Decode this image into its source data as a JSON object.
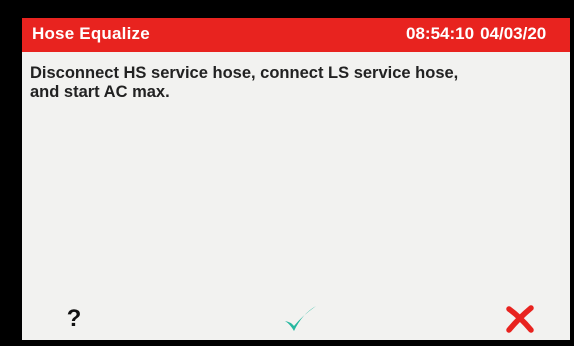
{
  "header": {
    "title": "Hose Equalize",
    "time": "08:54:10",
    "date": "04/03/20"
  },
  "message": {
    "line1": "Disconnect HS service hose, connect LS service hose,",
    "line2": "and start AC max."
  },
  "footer": {
    "help_label": "?",
    "ok_icon": "checkmark-icon",
    "cancel_icon": "x-icon"
  },
  "colors": {
    "title_bar": "#e8231f",
    "ok_icon": "#26b8a0",
    "cancel_icon": "#e8231f",
    "screen_background": "#f2f2f0"
  }
}
